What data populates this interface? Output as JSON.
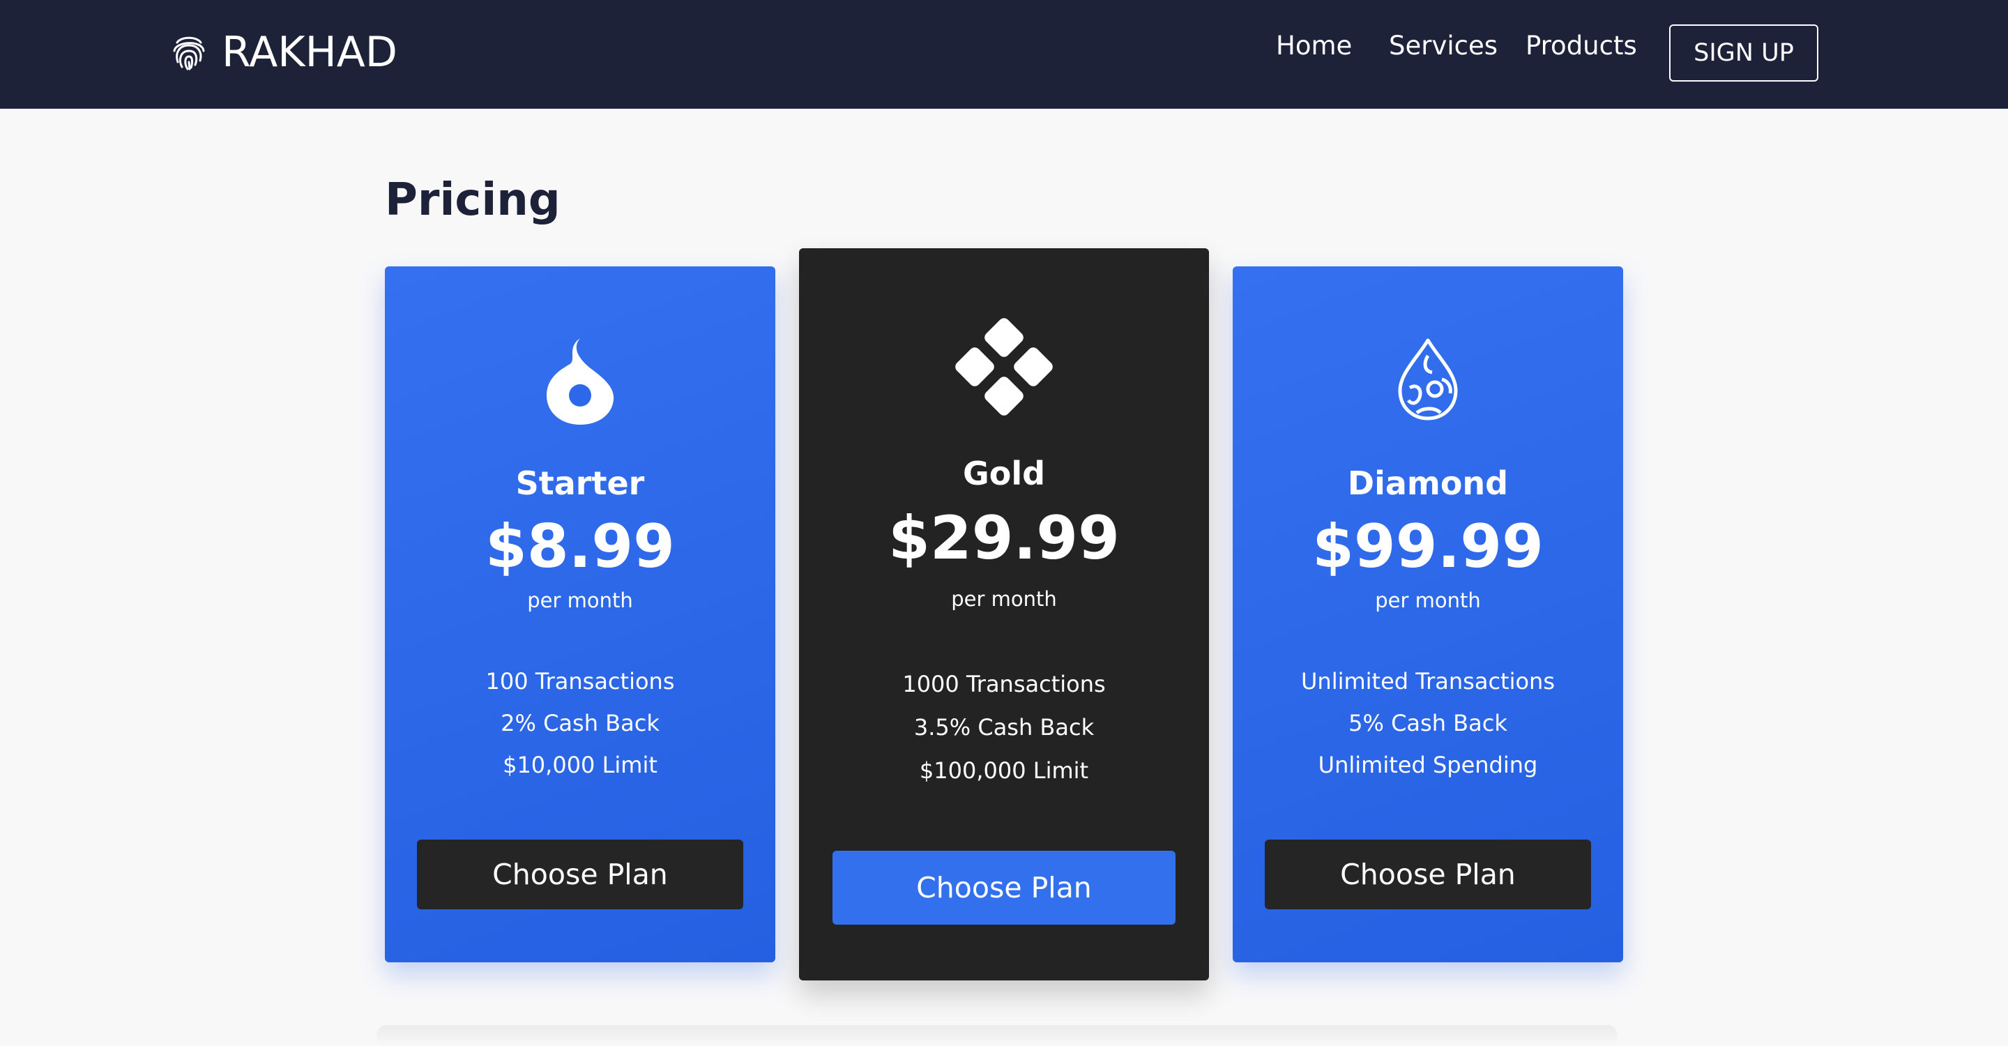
{
  "navbar": {
    "brand": "RAKHAD",
    "links": [
      "Home",
      "Services",
      "Products"
    ],
    "signup_label": "SIGN UP"
  },
  "pricing": {
    "heading": "Pricing",
    "plans": [
      {
        "name": "Starter",
        "price": "$8.99",
        "period": "per month",
        "features": [
          "100 Transactions",
          "2% Cash Back",
          "$10,000 Limit"
        ],
        "button_label": "Choose Plan",
        "icon": "flame-icon"
      },
      {
        "name": "Gold",
        "price": "$29.99",
        "period": "per month",
        "features": [
          "1000 Transactions",
          "3.5% Cash Back",
          "$100,000 Limit"
        ],
        "button_label": "Choose Plan",
        "icon": "diamond-grid-icon"
      },
      {
        "name": "Diamond",
        "price": "$99.99",
        "period": "per month",
        "features": [
          "Unlimited Transactions",
          "5% Cash Back",
          "Unlimited Spending"
        ],
        "button_label": "Choose Plan",
        "icon": "droplet-icon"
      }
    ]
  },
  "colors": {
    "navbar_bg": "#1d2239",
    "card_blue": "#2d68ea",
    "card_dark": "#232323",
    "page_bg": "#f8f8f9"
  }
}
